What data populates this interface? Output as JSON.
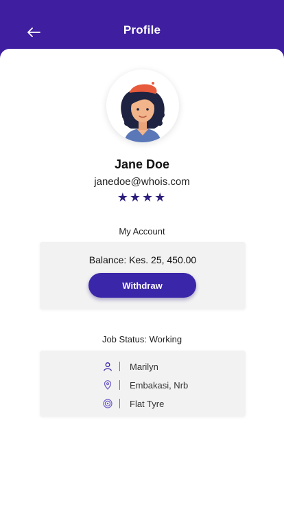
{
  "header": {
    "title": "Profile",
    "back_icon": "arrow-left-icon",
    "color": "#3f1fa0"
  },
  "profile": {
    "avatar_icon": "user-avatar-illustration",
    "name": "Jane Doe",
    "email": "janedoe@whois.com",
    "rating": 4,
    "rating_display": "★★★★"
  },
  "account": {
    "title": "My Account",
    "balance": "Balance: Kes. 25, 450.00",
    "withdraw_label": "Withdraw"
  },
  "job": {
    "title": "Job Status: Working",
    "items": [
      {
        "icon": "person-icon",
        "text": "Marilyn"
      },
      {
        "icon": "location-pin-icon",
        "text": "Embakasi, Nrb"
      },
      {
        "icon": "tyre-icon",
        "text": "Flat Tyre"
      }
    ]
  },
  "colors": {
    "accent": "#3a26a8",
    "star": "#2d1d7c",
    "card": "#f2f2f2"
  }
}
